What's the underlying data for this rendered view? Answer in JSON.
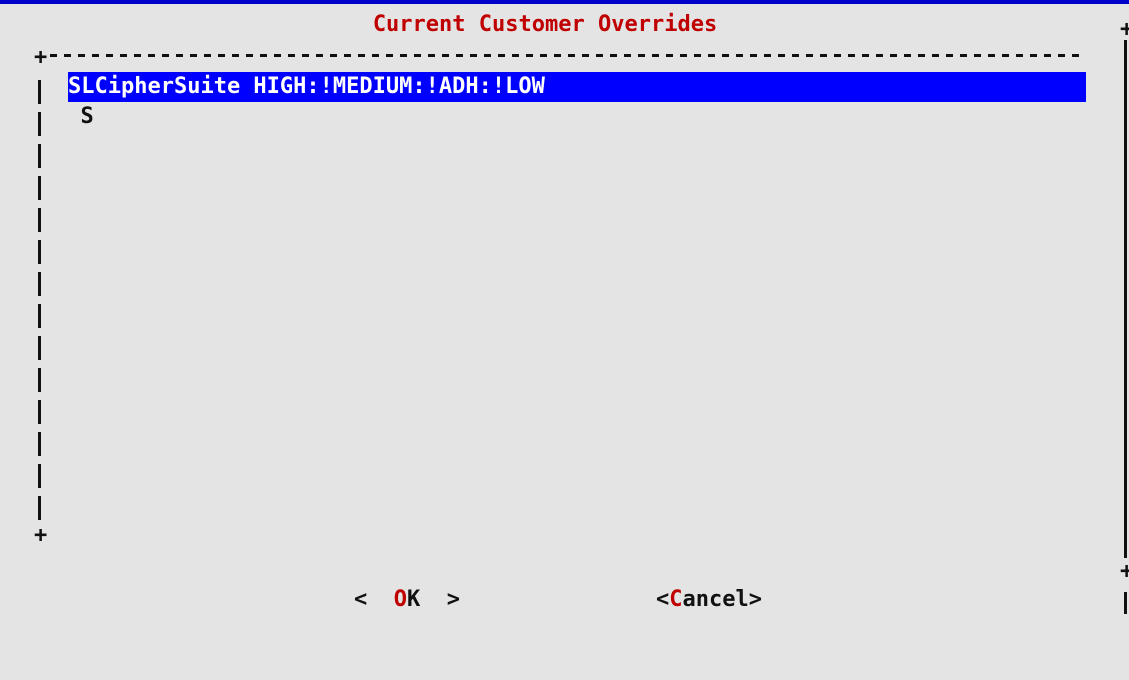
{
  "dialog": {
    "title": "Current Customer Overrides"
  },
  "list": {
    "items": [
      {
        "hotkey": "S",
        "rest": "SLCipherSuite HIGH:!MEDIUM:!ADH:!LOW"
      }
    ]
  },
  "buttons": {
    "ok": {
      "left": "<  ",
      "hotkey": "O",
      "rest": "K",
      "right": "  >"
    },
    "cancel": {
      "left": "<",
      "hotkey": "C",
      "rest": "ancel",
      "right": ">"
    }
  },
  "colors": {
    "background": "#e4e4e4",
    "title": "#c00000",
    "selection": "#0000ff",
    "hotkey": "#c00000",
    "frame": "#111111"
  }
}
